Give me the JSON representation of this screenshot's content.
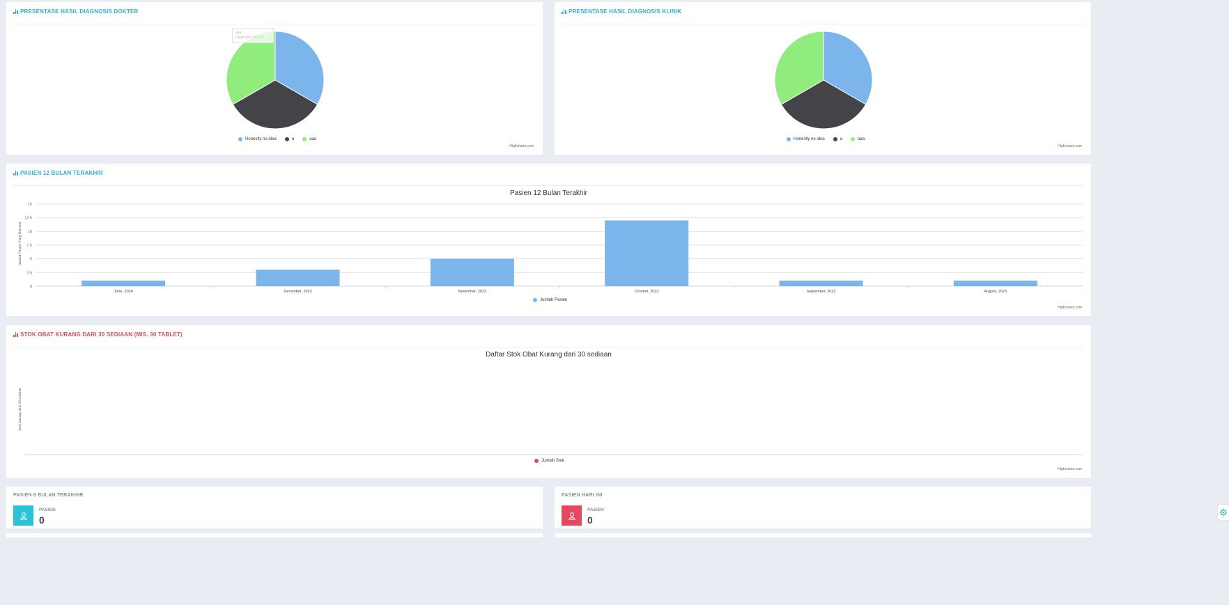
{
  "panels": {
    "doctor": {
      "title": "PRESENTASE HASIL DIAGNOSIS DOKTER",
      "tooltip_line1": "aaa",
      "tooltip_line2": "Diagnosis: 33.3 %",
      "credit": "Highcharts.com"
    },
    "clinic": {
      "title": "PRESENTASE HASIL DIAGNOSIS KLINIK",
      "credit": "Highcharts.com"
    },
    "patients": {
      "title": "PASIEN 12 BULAN TERAKHIR",
      "credit": "Highcharts.com"
    },
    "stock": {
      "title": "STOK OBAT KURANG DARI 30 SEDIAAN (MIS. 30 TABLET)",
      "credit": "Highcharts.com"
    }
  },
  "stats": {
    "patients_6m": {
      "label": "PASIEN 6 BULAN TERAKHIR",
      "small_label": "PASIEN",
      "value": "0",
      "color": "#2bc4d6",
      "icon": "user-icon"
    },
    "patients_today": {
      "label": "PASIEN HARI INI",
      "small_label": "PASIEN",
      "value": "0",
      "color": "#e5485f",
      "icon": "user-icon"
    }
  },
  "chart_data": [
    {
      "type": "pie",
      "labels": [
        "Honestly no idea",
        "a",
        "aaa"
      ],
      "values": [
        33.3,
        33.3,
        33.3
      ],
      "colors": [
        "#7cb5ec",
        "#434348",
        "#90ed7d"
      ],
      "legend": "bottom-center"
    },
    {
      "type": "pie",
      "labels": [
        "Honestly no idea",
        "a",
        "aaa"
      ],
      "values": [
        33.3,
        33.3,
        33.3
      ],
      "colors": [
        "#7cb5ec",
        "#434348",
        "#90ed7d"
      ],
      "legend": "bottom-center"
    },
    {
      "type": "bar",
      "title": "Pasien 12 Bulan Terakhir",
      "ylabel": "Jumlah Pasien Yang Berobat",
      "categories": [
        "June, 2024",
        "December, 2023",
        "November, 2023",
        "October, 2023",
        "September, 2023",
        "August, 2023"
      ],
      "series": [
        {
          "name": "Jumlah Pasien",
          "values": [
            1,
            3,
            5,
            12,
            1,
            1
          ],
          "color": "#7cb5ec"
        }
      ],
      "ylim": [
        0,
        15
      ],
      "yticks": [
        "0",
        "2.5",
        "5",
        "7.5",
        "10",
        "12.5",
        "15"
      ],
      "grid": true,
      "legend": "bottom-center"
    },
    {
      "type": "bar",
      "title": "Daftar Stok Obat Kurang dari 30 sediaan",
      "ylabel": "Stok kurang dari 30 sediaan",
      "categories": [],
      "series": [
        {
          "name": "Jumlah Stok",
          "values": [],
          "color": "#e5485f"
        }
      ],
      "legend": "bottom-center"
    }
  ]
}
